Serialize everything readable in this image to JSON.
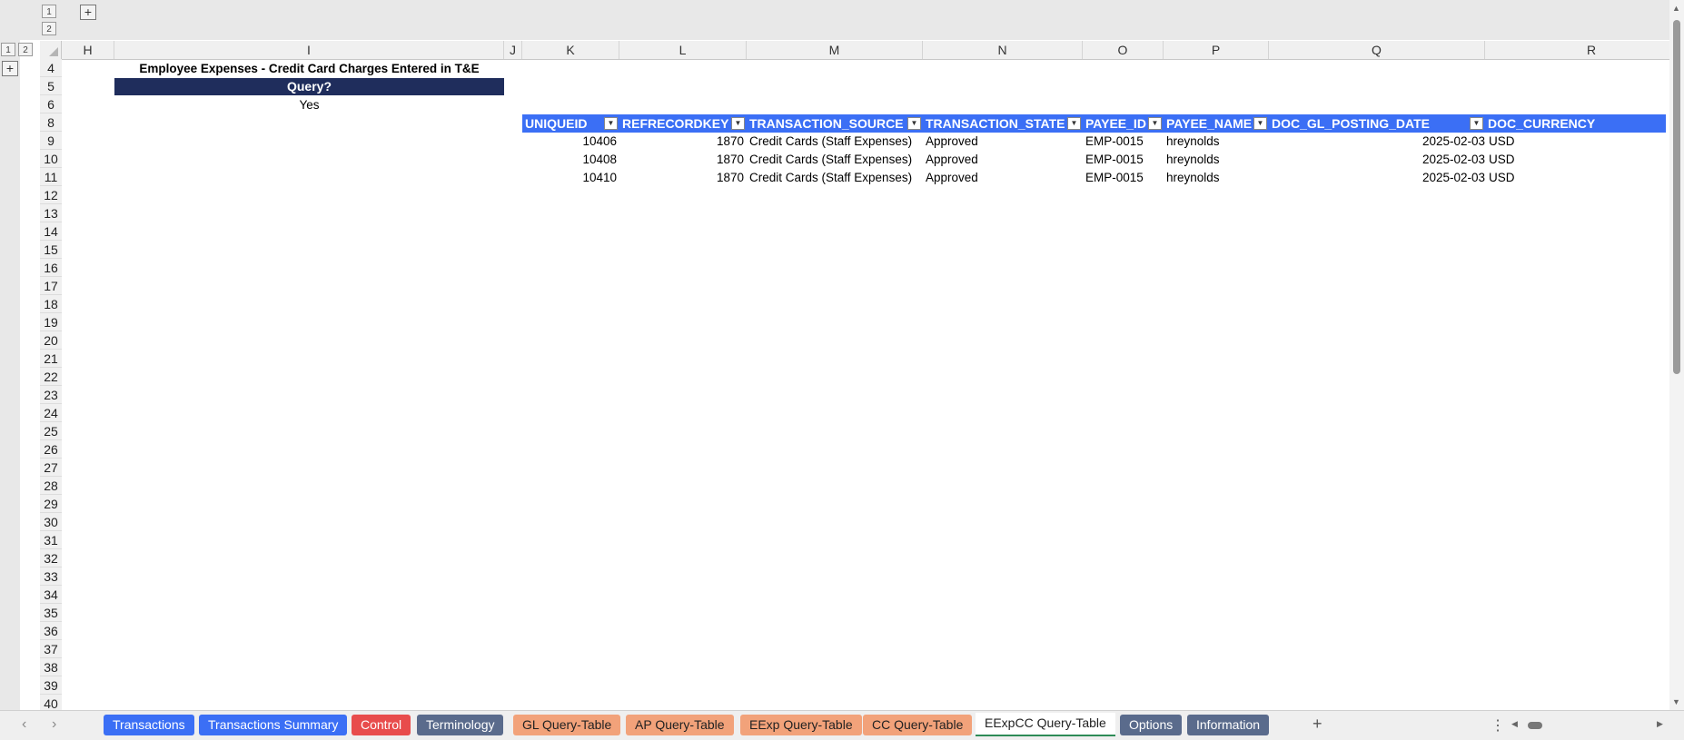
{
  "outline": {
    "levels_top": [
      "1",
      "2"
    ],
    "levels_left": [
      "1",
      "2"
    ],
    "expand_symbol": "+"
  },
  "columns": [
    "H",
    "I",
    "J",
    "K",
    "L",
    "M",
    "N",
    "O",
    "P",
    "Q",
    "R"
  ],
  "rows": [
    "4",
    "5",
    "6",
    "8",
    "9",
    "10",
    "11",
    "12",
    "13",
    "14",
    "15",
    "16",
    "17",
    "18",
    "19",
    "20",
    "21",
    "22",
    "23",
    "24",
    "25",
    "26",
    "27",
    "28",
    "29",
    "30",
    "31",
    "32",
    "33",
    "34",
    "35",
    "36",
    "37",
    "38",
    "39",
    "40"
  ],
  "sheet": {
    "title": "Employee Expenses - Credit Card Charges Entered in T&E",
    "query_label": "Query?",
    "query_value": "Yes",
    "header_color": "#3b6ff5",
    "band_color": "#1f2d5c",
    "table_headers": [
      "UNIQUEID",
      "REFRECORDKEY",
      "TRANSACTION_SOURCE",
      "TRANSACTION_STATE",
      "PAYEE_ID",
      "PAYEE_NAME",
      "DOC_GL_POSTING_DATE",
      "DOC_CURRENCY"
    ],
    "table_rows": [
      [
        "10406",
        "1870",
        "Credit Cards (Staff Expenses)",
        "Approved",
        "EMP-0015",
        "hreynolds",
        "2025-02-03",
        "USD"
      ],
      [
        "10408",
        "1870",
        "Credit Cards (Staff Expenses)",
        "Approved",
        "EMP-0015",
        "hreynolds",
        "2025-02-03",
        "USD"
      ],
      [
        "10410",
        "1870",
        "Credit Cards (Staff Expenses)",
        "Approved",
        "EMP-0015",
        "hreynolds",
        "2025-02-03",
        "USD"
      ]
    ]
  },
  "tabs": [
    {
      "label": "Transactions",
      "bg": "#3b6ff5",
      "fg": "#ffffff"
    },
    {
      "label": "Transactions Summary",
      "bg": "#3b6ff5",
      "fg": "#ffffff"
    },
    {
      "label": "Control",
      "bg": "#e84c4c",
      "fg": "#ffffff"
    },
    {
      "label": "Terminology",
      "bg": "#5a6b8c",
      "fg": "#ffffff"
    },
    {
      "label": "GL Query-Table",
      "bg": "#f2a27a",
      "fg": "#222222"
    },
    {
      "label": "AP Query-Table",
      "bg": "#f2a27a",
      "fg": "#222222"
    },
    {
      "label": "EExp Query-Table",
      "bg": "#f2a27a",
      "fg": "#222222"
    },
    {
      "label": "CC Query-Table",
      "bg": "#f2a27a",
      "fg": "#222222"
    },
    {
      "label": "EExpCC Query-Table",
      "bg": "#ffffff",
      "fg": "#222222",
      "active": true
    },
    {
      "label": "Options",
      "bg": "#5a6b8c",
      "fg": "#ffffff"
    },
    {
      "label": "Information",
      "bg": "#5a6b8c",
      "fg": "#ffffff"
    }
  ],
  "tabbar": {
    "add_symbol": "+",
    "menu_symbol": "⋮",
    "prev_symbol": "‹",
    "next_symbol": "›"
  }
}
